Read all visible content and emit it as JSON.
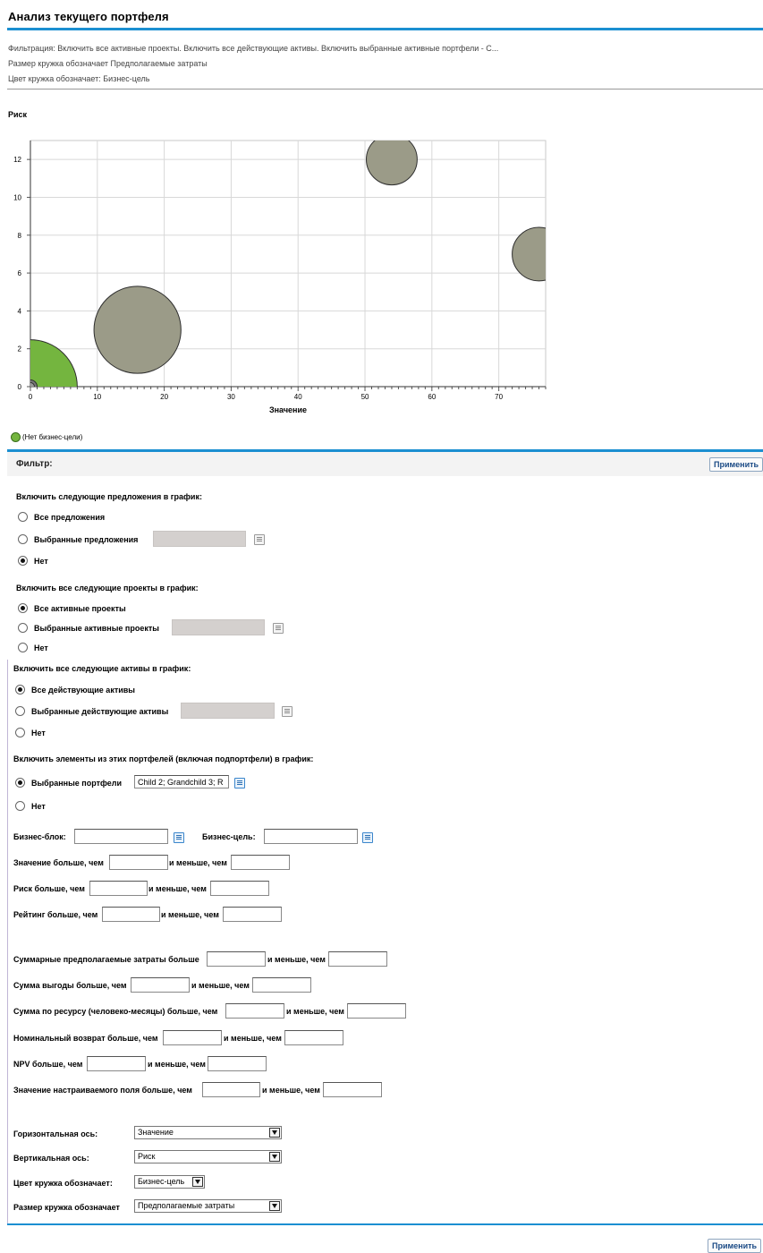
{
  "page": {
    "title": "Анализ текущего портфеля",
    "desc_filter": "Фильтрация: Включить все активные проекты. Включить все действующие активы. Включить выбранные активные портфели - C...",
    "desc_size": "Размер кружка обозначает Предполагаемые затраты",
    "desc_color": "Цвет кружка обозначает: Бизнес-цель"
  },
  "chart_data": {
    "type": "scatter",
    "title": "Риск",
    "xlabel": "Значение",
    "ylabel": "",
    "xlim": [
      0,
      77
    ],
    "ylim": [
      0,
      13
    ],
    "x_ticks": [
      0,
      10,
      20,
      30,
      40,
      50,
      60,
      70
    ],
    "y_ticks": [
      0,
      2,
      4,
      6,
      8,
      10,
      12
    ],
    "grid": true,
    "legend": [
      {
        "name": "(Нет бизнес-цели)",
        "color": "#74b53f"
      }
    ],
    "points": [
      {
        "x": 0,
        "y": 0,
        "size": 7,
        "color": "#74b53f"
      },
      {
        "x": 0,
        "y": 0,
        "size": 1,
        "color": "#777777"
      },
      {
        "x": 0,
        "y": 0,
        "size": 0.6,
        "color": "#999999"
      },
      {
        "x": 16,
        "y": 3,
        "size": 6.5,
        "color": "#9b9b88"
      },
      {
        "x": 54,
        "y": 12,
        "size": 3.8,
        "color": "#9b9b88"
      },
      {
        "x": 76,
        "y": 7,
        "size": 4,
        "color": "#9b9b88"
      }
    ]
  },
  "filter": {
    "header": "Фильтр:",
    "apply_label": "Применить",
    "proposals": {
      "heading": "Включить следующие предложения в график:",
      "opt_all": "Все предложения",
      "opt_selected": "Выбранные предложения",
      "opt_none": "Нет",
      "selected": "none"
    },
    "projects": {
      "heading": "Включить все следующие проекты в график:",
      "opt_all": "Все активные проекты",
      "opt_selected": "Выбранные активные проекты",
      "opt_none": "Нет",
      "selected": "all"
    },
    "assets": {
      "heading": "Включить все следующие активы в график:",
      "opt_all": "Все действующие активы",
      "opt_selected": "Выбранные действующие активы",
      "opt_none": "Нет",
      "selected": "all"
    },
    "portfolios": {
      "heading": "Включить элементы из этих портфелей (включая подпортфели) в график:",
      "opt_selected": "Выбранные портфели",
      "opt_none": "Нет",
      "value": "Child 2; Grandchild 3; R",
      "selected": "selected"
    },
    "business_unit_label": "Бизнес-блок:",
    "business_goal_label": "Бизнес-цель:",
    "and_less": "и меньше, чем",
    "value_more": "Значение больше, чем",
    "risk_more": "Риск больше, чем",
    "rating_more": "Рейтинг больше, чем",
    "total_cost_more": "Суммарные предполагаемые затраты больше",
    "benefit_more": "Сумма выгоды больше, чем",
    "resource_more": "Сумма по ресурсу (человеко-месяцы) больше, чем",
    "nominal_more": "Номинальный возврат больше, чем",
    "npv_more": "NPV больше, чем",
    "custom_more": "Значение настраиваемого поля больше, чем",
    "h_axis_label": "Горизонтальная ось:",
    "h_axis_value": "Значение",
    "v_axis_label": "Вертикальная ось:",
    "v_axis_value": "Риск",
    "color_label": "Цвет кружка обозначает:",
    "color_value": "Бизнес-цель",
    "size_label": "Размер кружка обозначает",
    "size_value": "Предполагаемые затраты"
  }
}
